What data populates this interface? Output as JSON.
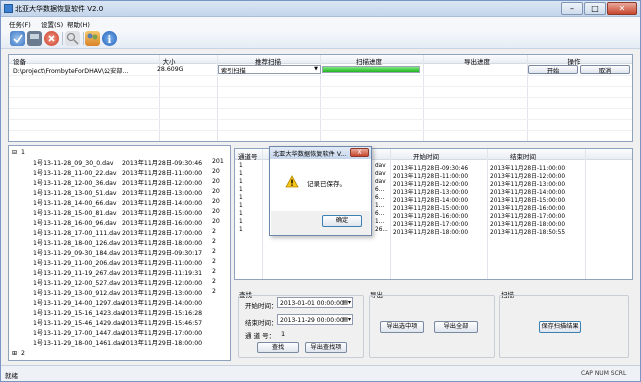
{
  "window": {
    "title": "北亚大华数据恢复软件 V2.0",
    "min": "–",
    "max": "□",
    "close": "✕"
  },
  "menu": [
    "任务(F)",
    "设置(S)",
    "帮助(H)"
  ],
  "toolbar_icons": [
    "check-icon",
    "disk-icon",
    "stop-icon",
    "search-icon",
    "users-icon",
    "info-icon"
  ],
  "devices": {
    "headers": [
      "设备",
      "大小",
      "推荐扫描",
      "扫描进度",
      "导出进度",
      "操作"
    ],
    "row": {
      "device": "D:\\project\\FrombyteForDHAV\\公安部...",
      "size": "28.609G",
      "scan_type": "索引扫描",
      "scan_progress": 1.0,
      "start": "开始",
      "cancel": "取消"
    }
  },
  "tree": {
    "node1": {
      "toggle": "⊟",
      "label": "1"
    },
    "node2": {
      "toggle": "⊞",
      "label": "2"
    },
    "files": [
      {
        "name": "1号13-11-28_09_30_0.dav",
        "time": "2013年11月28日-09:30:46",
        "num": "201"
      },
      {
        "name": "1号13-11-28_11-00_22.dav",
        "time": "2013年11月28日-11:00:00",
        "num": "20"
      },
      {
        "name": "1号13-11-28_12-00_36.dav",
        "time": "2013年11月28日-12:00:00",
        "num": "20"
      },
      {
        "name": "1号13-11-28_13-00_51.dav",
        "time": "2013年11月28日-13:00:00",
        "num": "20"
      },
      {
        "name": "1号13-11-28_14-00_66.dav",
        "time": "2013年11月28日-14:00:00",
        "num": "20"
      },
      {
        "name": "1号13-11-28_15-00_81.dav",
        "time": "2013年11月28日-15:00:00",
        "num": "20"
      },
      {
        "name": "1号13-11-28_16-00_96.dav",
        "time": "2013年11月28日-16:00:00",
        "num": "20"
      },
      {
        "name": "1号13-11-28_17-00_111.dav",
        "time": "2013年11月28日-17:00:00",
        "num": "2"
      },
      {
        "name": "1号13-11-28_18-00_126.dav",
        "time": "2013年11月28日-18:00:00",
        "num": "2"
      },
      {
        "name": "1号13-11-29_09-30_184.dav",
        "time": "2013年11月29日-09:30:17",
        "num": "2"
      },
      {
        "name": "1号13-11-29_11-00_206.dav",
        "time": "2013年11月29日-11:00:00",
        "num": "2"
      },
      {
        "name": "1号13-11-29_11-19_267.dav",
        "time": "2013年11月29日-11:19:31",
        "num": "2"
      },
      {
        "name": "1号13-11-29_12-00_527.dav",
        "time": "2013年11月29日-12:00:00",
        "num": "2"
      },
      {
        "name": "1号13-11-29_13-00_912.dav",
        "time": "2013年11月29日-13:00:00",
        "num": "2"
      },
      {
        "name": "1号13-11-29_14-00_1297.dav",
        "time": "2013年11月29日-14:00:00",
        "num": ""
      },
      {
        "name": "1号13-11-29_15-16_1423.dav",
        "time": "2013年11月29日-15:16:28",
        "num": ""
      },
      {
        "name": "1号13-11-29_15-46_1429.dav",
        "time": "2013年11月29日-15:46:57",
        "num": ""
      },
      {
        "name": "1号13-11-29_17-00_1447.dav",
        "time": "2013年11月29日-17:00:00",
        "num": ""
      },
      {
        "name": "1号13-11-29_18-00_1461.dav",
        "time": "2013年11月29日-18:00:00",
        "num": ""
      }
    ]
  },
  "channels": {
    "headers": [
      "通道号",
      "开始时间",
      "结束时间"
    ],
    "rows": [
      {
        "ch": "1",
        "name": "dav",
        "start": "2013年11月28日-09:30:46",
        "end": "2013年11月28日-11:00:00"
      },
      {
        "ch": "1",
        "name": "dav",
        "start": "2013年11月28日-11:00:00",
        "end": "2013年11月28日-12:00:00"
      },
      {
        "ch": "1",
        "name": "dav",
        "start": "2013年11月28日-12:00:00",
        "end": "2013年11月28日-13:00:00"
      },
      {
        "ch": "1",
        "name": "6...",
        "start": "2013年11月28日-13:00:00",
        "end": "2013年11月28日-14:00:00"
      },
      {
        "ch": "1",
        "name": "6...",
        "start": "2013年11月28日-14:00:00",
        "end": "2013年11月28日-15:00:00"
      },
      {
        "ch": "1",
        "name": "1...",
        "start": "2013年11月28日-15:00:00",
        "end": "2013年11月28日-16:00:00"
      },
      {
        "ch": "1",
        "name": "6...",
        "start": "2013年11月28日-16:00:00",
        "end": "2013年11月28日-17:00:00"
      },
      {
        "ch": "1",
        "name": "1...",
        "start": "2013年11月28日-17:00:00",
        "end": "2013年11月28日-18:00:00"
      },
      {
        "ch": "1",
        "name": "26...",
        "start": "2013年11月28日-18:00:00",
        "end": "2013年11月28日-18:50:55"
      }
    ]
  },
  "dialog": {
    "title": "北亚大华数据恢复软件 V...",
    "close": "X",
    "message": "记录已保存。",
    "ok": "确定"
  },
  "search": {
    "group": "查找",
    "start_label": "开始时间：",
    "start_value": "2013-01-01 00:00:00",
    "end_label": "结束时间：",
    "end_value": "2013-11-29 00:00:00",
    "channel_label": "通 道 号：",
    "channel_value": "1",
    "find": "查找",
    "export_find": "导出查找项"
  },
  "export": {
    "group": "导出",
    "export_selected": "导出选中项",
    "export_all": "导出全部"
  },
  "scan": {
    "group": "扫描",
    "save_result": "保存扫描结果"
  },
  "status": {
    "left": "就绪",
    "right": "CAP  NUM  SCRL"
  }
}
